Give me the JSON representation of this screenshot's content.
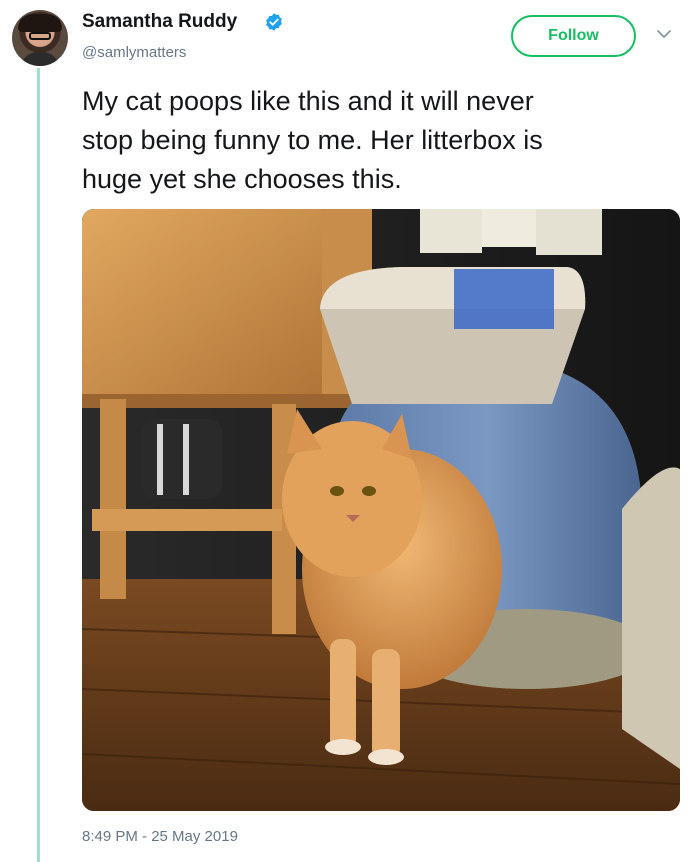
{
  "author": {
    "name": "Samantha Ruddy",
    "handle": "@samlymatters",
    "verified": true,
    "avatar_icon": "profile-photo"
  },
  "follow_label": "Follow",
  "tweet": {
    "text": "My cat poops like this and it will never\nstop being funny to me. Her litterbox is\nhuge yet she chooses this.",
    "timestamp": "8:49 PM - 25 May 2019"
  },
  "colors": {
    "accent": "#17bf63",
    "verified": "#1da1f2",
    "thread_line": "#9ee0d0",
    "muted": "#657786"
  }
}
